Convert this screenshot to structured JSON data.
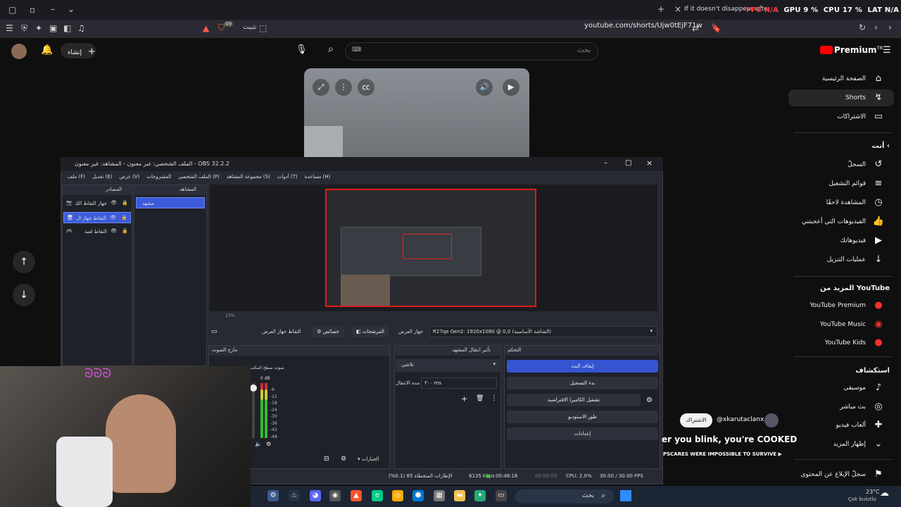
{
  "browser": {
    "tab_title": "If it doesn't disappear after...",
    "stats": {
      "fps": "FPS N/A",
      "gpu": "GPU 9 %",
      "cpu": "CPU 17 %",
      "lat": "LAT N/A"
    },
    "url": "youtube.com/shorts/Ujw0tEjF71w",
    "install_label": "تثبيت",
    "notif_badge": "49"
  },
  "youtube": {
    "logo": "Premium",
    "logo_sup": "TR",
    "search_placeholder": "بحث",
    "create_label": "إنشاء",
    "sidebar": {
      "main": [
        {
          "label": "الصفحة الرئيسية",
          "icon": "home-icon",
          "glyph": "⌂"
        },
        {
          "label": "Shorts",
          "icon": "shorts-icon",
          "glyph": "↯",
          "active": true
        },
        {
          "label": "الاشتراكات",
          "icon": "subscriptions-icon",
          "glyph": "▭"
        }
      ],
      "you_header": "أنت",
      "you": [
        {
          "label": "السجلّ",
          "icon": "history-icon",
          "glyph": "↺"
        },
        {
          "label": "قوائم التشغيل",
          "icon": "playlists-icon",
          "glyph": "≡"
        },
        {
          "label": "المشاهدة لاحقًا",
          "icon": "watch-later-icon",
          "glyph": "◷"
        },
        {
          "label": "الفيديوهات التي أعجبتني",
          "icon": "like-icon",
          "glyph": "👍"
        },
        {
          "label": "فيديوهاتك",
          "icon": "your-videos-icon",
          "glyph": "▶"
        },
        {
          "label": "عمليات التنزيل",
          "icon": "download-icon",
          "glyph": "↓"
        }
      ],
      "more_header": "المزيد من YouTube",
      "more": [
        {
          "label": "YouTube Premium",
          "icon": "yt-premium-icon",
          "glyph": "●"
        },
        {
          "label": "YouTube Music",
          "icon": "yt-music-icon",
          "glyph": "◉"
        },
        {
          "label": "YouTube Kids",
          "icon": "yt-kids-icon",
          "glyph": "●"
        }
      ],
      "explore_header": "استكشاف",
      "explore": [
        {
          "label": "موسيقى",
          "icon": "music-icon",
          "glyph": "♪"
        },
        {
          "label": "بث مباشر",
          "icon": "live-icon",
          "glyph": "◎"
        },
        {
          "label": "ألعاب فيديو",
          "icon": "gaming-icon",
          "glyph": "✚"
        },
        {
          "label": "إظهار المزيد",
          "icon": "chevron-down-icon",
          "glyph": "⌄"
        }
      ],
      "report": {
        "label": "سجلّ الإبلاغ عن المحتوى",
        "icon": "flag-icon",
        "glyph": "⚑"
      }
    },
    "short_overlay": {
      "title": "er you blink, you're COOKED",
      "subtitle": "PSCARES WERE IMPOSSIBLE TO SURVIVE ▶",
      "channel": "@xkarutaclanx",
      "subscribe": "الاشتراك"
    }
  },
  "obs": {
    "title": "الملف الشخصي: غير معنون - المشاهد: غير معنون - OBS 32.2.2",
    "menu": [
      "ملف (F)",
      "تعديل (E)",
      "عرض (V)",
      "المشروحات",
      "الملف الشخصي (P)",
      "مجموعة المشاهد (S)",
      "أدوات (T)",
      "مساعدة (H)"
    ],
    "sources_header": "المصادر",
    "sources": [
      {
        "label": "جهاز التقاط الك",
        "selected": false
      },
      {
        "label": "التقاط جهاز ال",
        "selected": true
      },
      {
        "label": "التقاط لعبة",
        "selected": false
      }
    ],
    "scenes_header": "المشاهد",
    "scenes": [
      "مشهد"
    ],
    "zoom": "23%",
    "device_toolbar": {
      "properties": "خصائص",
      "filters": "المرشحات",
      "device_label": "جهاز العرض",
      "device_value": "R27qe Gen2: 1920x1080 @ 0,0 (الشاشة الأساسية)",
      "capture_label": "التقاط جهاز العرض"
    },
    "mixer_header": "مازج الصوت",
    "mixer_channel": "صوت سطح المكتب",
    "mixer_db": "0 dB",
    "mixer_ticks": [
      "-6",
      "-12",
      "-18",
      "-24",
      "-30",
      "-36",
      "-42",
      "-48"
    ],
    "transition_header": "تأثير انتقال المشهد",
    "transition_value": "تلاشي",
    "transition_duration_label": "مدة الانتقال",
    "transition_duration": "٣٠٠ ms",
    "controls_header": "التحكم",
    "controls": [
      "إيقاف البث",
      "بدء التسجيل",
      "تشغيل الكاميرا الافتراضية",
      "طور الاستوديو",
      "إعدادات"
    ],
    "status": {
      "frames": "الإطارات المتخطاة 85 (0.1%)",
      "bitrate": "6135 kbps",
      "live_time": "00:48:16",
      "rec_time": "00:00:00",
      "cpu": "CPU: 2.0%",
      "fps": "30.00 / 30.00 FPS"
    },
    "mixer_footer": "الخيارات"
  },
  "taskbar": {
    "search": "بحث",
    "weather_temp": "23°C",
    "weather_desc": "Çok bulutlu"
  }
}
